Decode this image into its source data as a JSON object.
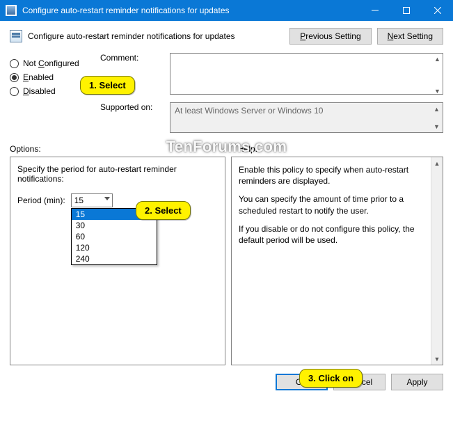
{
  "window": {
    "title": "Configure auto-restart reminder notifications for updates"
  },
  "header": {
    "title": "Configure auto-restart reminder notifications for updates",
    "prev_p": "P",
    "prev_rest": "revious Setting",
    "next_n": "N",
    "next_rest": "ext Setting"
  },
  "radios": {
    "not_configured_c": "C",
    "not_configured_rest": "onfigured",
    "not_prefix": "Not ",
    "enabled_e": "E",
    "enabled_rest": "nabled",
    "disabled_d": "D",
    "disabled_rest": "isabled"
  },
  "labels": {
    "comment": "Comment:",
    "supported": "Supported on:",
    "options": "Options:",
    "help": "Help:",
    "period": "Period (min):"
  },
  "supported_text": "At least Windows Server or Windows 10",
  "options_text": "Specify the period for auto-restart reminder notifications:",
  "period_value": "15",
  "dropdown_options": [
    "15",
    "30",
    "60",
    "120",
    "240"
  ],
  "help_text": {
    "p1": "Enable this policy to specify when auto-restart reminders are displayed.",
    "p2": "You can specify the amount of time prior to a scheduled restart to notify the user.",
    "p3": "If you disable or do not configure this policy, the default period will be used."
  },
  "footer": {
    "ok": "OK",
    "cancel": "Cancel",
    "apply": "Apply"
  },
  "callouts": {
    "c1": "1. Select",
    "c2": "2. Select",
    "c3": "3. Click on"
  },
  "watermark": "TenForums.com"
}
